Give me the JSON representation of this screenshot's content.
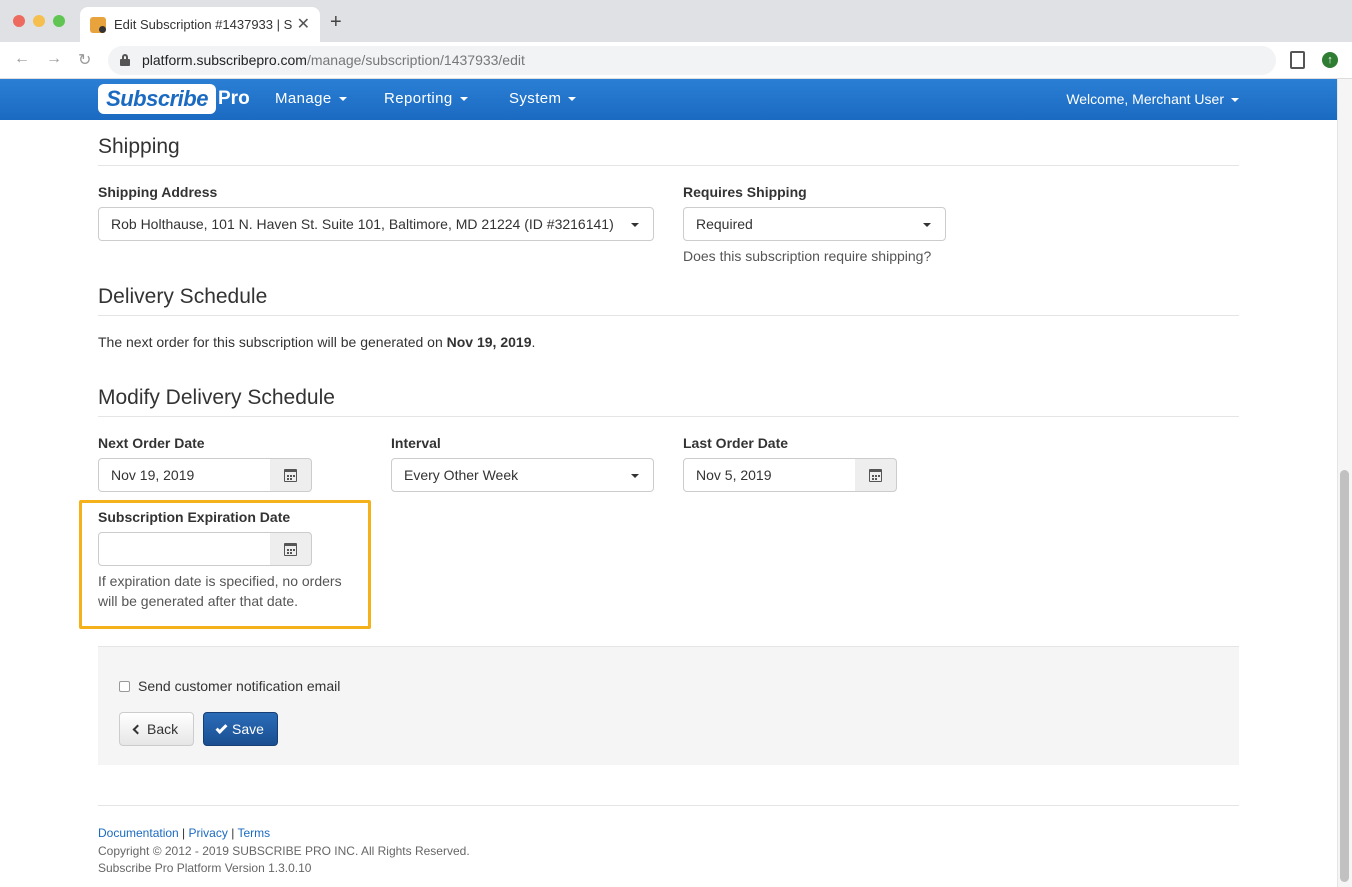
{
  "browser": {
    "tab_title": "Edit Subscription #1437933 | S",
    "url_host": "platform.subscribepro.com",
    "url_path": "/manage/subscription/1437933/edit"
  },
  "navbar": {
    "logo_main": "Subscribe",
    "logo_pro": "Pro",
    "items": [
      {
        "label": "Manage"
      },
      {
        "label": "Reporting"
      },
      {
        "label": "System"
      }
    ],
    "welcome": "Welcome, Merchant User"
  },
  "shipping": {
    "title": "Shipping",
    "address_label": "Shipping Address",
    "address_value": "Rob Holthause, 101 N. Haven St. Suite 101, Baltimore, MD 21224 (ID #3216141)",
    "requires_label": "Requires Shipping",
    "requires_value": "Required",
    "requires_help": "Does this subscription require shipping?"
  },
  "delivery": {
    "title": "Delivery Schedule",
    "text_prefix": "The next order for this subscription will be generated on ",
    "next_date": "Nov 19, 2019",
    "text_suffix": "."
  },
  "modify": {
    "title": "Modify Delivery Schedule",
    "next_order_label": "Next Order Date",
    "next_order_value": "Nov 19, 2019",
    "interval_label": "Interval",
    "interval_value": "Every Other Week",
    "last_order_label": "Last Order Date",
    "last_order_value": "Nov 5, 2019",
    "expiration_label": "Subscription Expiration Date",
    "expiration_value": "",
    "expiration_help": "If expiration date is specified, no orders will be generated after that date."
  },
  "actions": {
    "notify_label": "Send customer notification email",
    "back_label": "Back",
    "save_label": "Save"
  },
  "footer": {
    "links": [
      "Documentation",
      "Privacy",
      "Terms"
    ],
    "copyright": "Copyright © 2012 - 2019 SUBSCRIBE PRO INC. All Rights Reserved.",
    "version": "Subscribe Pro Platform Version 1.3.0.10"
  },
  "colors": {
    "navbar": "#1b6ac1",
    "highlight": "#f5b11a",
    "save_button": "#1a4f91"
  }
}
